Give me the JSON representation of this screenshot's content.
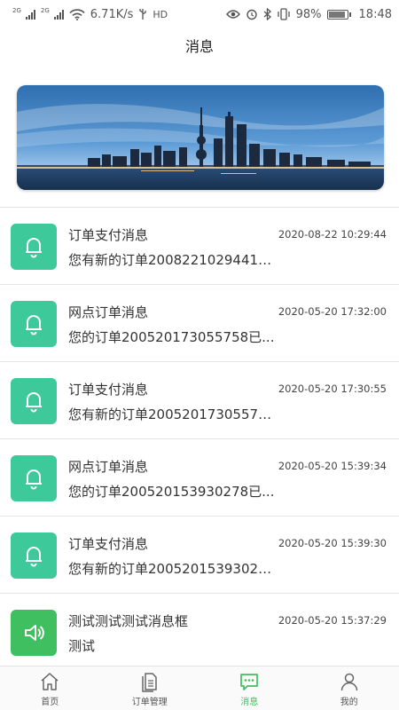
{
  "status_bar": {
    "net_tag_1": "2G",
    "net_tag_2": "2G",
    "speed": "6.71K/s",
    "hd": "HD",
    "battery": "98%",
    "time": "18:48"
  },
  "header": {
    "title": "消息"
  },
  "banner": {
    "icon": "city-skyline-image"
  },
  "messages": [
    {
      "title": "订单支付消息",
      "time": "2020-08-22 10:29:44",
      "content": "您有新的订单20082210294416...",
      "icon": "bell-icon"
    },
    {
      "title": "网点订单消息",
      "time": "2020-05-20 17:32:00",
      "content": "您的订单200520173055758已...",
      "icon": "bell-icon"
    },
    {
      "title": "订单支付消息",
      "time": "2020-05-20 17:30:55",
      "content": "您有新的订单20052017305575...",
      "icon": "bell-icon"
    },
    {
      "title": "网点订单消息",
      "time": "2020-05-20 15:39:34",
      "content": "您的订单200520153930278已...",
      "icon": "bell-icon"
    },
    {
      "title": "订单支付消息",
      "time": "2020-05-20 15:39:30",
      "content": "您有新的订单20052015393027...",
      "icon": "bell-icon"
    },
    {
      "title": "测试测试测试消息框",
      "time": "2020-05-20 15:37:29",
      "content": "测试",
      "icon": "speaker-icon"
    }
  ],
  "tab_bar": {
    "active_color": "#3fbf5f",
    "items": [
      {
        "label": "首页",
        "icon": "home-icon"
      },
      {
        "label": "订单管理",
        "icon": "document-icon"
      },
      {
        "label": "消息",
        "icon": "chat-icon"
      },
      {
        "label": "我的",
        "icon": "person-icon"
      }
    ]
  }
}
